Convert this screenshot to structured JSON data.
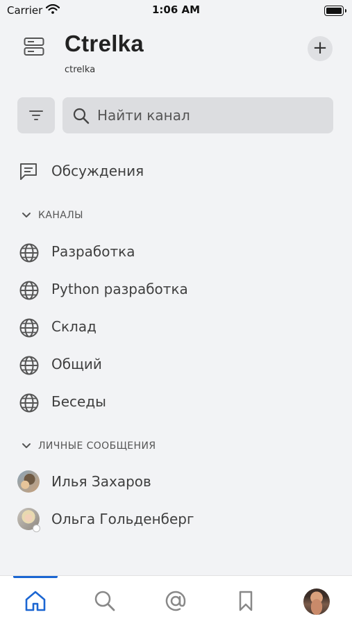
{
  "status_bar": {
    "carrier": "Carrier",
    "time": "1:06 AM"
  },
  "header": {
    "title": "Ctrelka",
    "subtitle": "ctrelka",
    "add_label": "+"
  },
  "search": {
    "placeholder": "Найти канал"
  },
  "discussions": {
    "label": "Обсуждения"
  },
  "channels": {
    "header": "КАНАЛЫ",
    "items": [
      {
        "label": "Разработка"
      },
      {
        "label": "Python разработка"
      },
      {
        "label": "Склад"
      },
      {
        "label": "Общий"
      },
      {
        "label": "Беседы"
      }
    ]
  },
  "direct_messages": {
    "header": "ЛИЧНЫЕ СООБЩЕНИЯ",
    "items": [
      {
        "label": "Илья Захаров"
      },
      {
        "label": "Ольга Гольденберг"
      }
    ]
  },
  "tab_bar": {
    "tabs": [
      "home-icon",
      "search-icon",
      "mention-icon",
      "bookmark-icon",
      "profile-avatar"
    ],
    "active": "home",
    "accent_color": "#1b66d2"
  }
}
